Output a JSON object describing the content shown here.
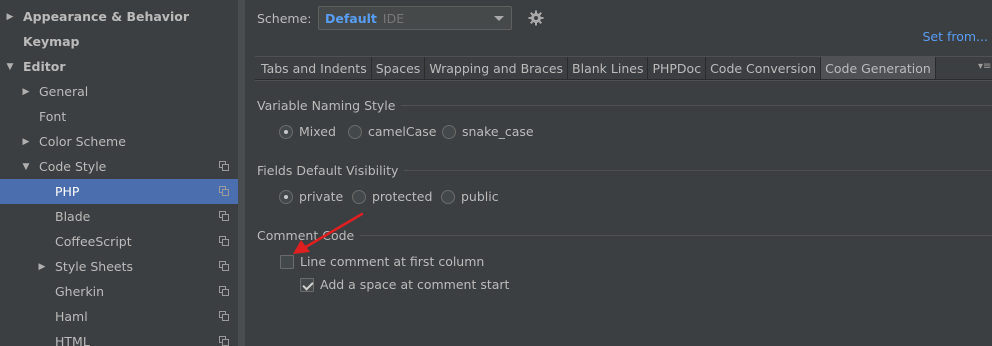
{
  "sidebar": {
    "items": [
      {
        "label": "Appearance & Behavior",
        "expanded": false
      },
      {
        "label": "Keymap"
      },
      {
        "label": "Editor",
        "expanded": true
      },
      {
        "label": "General",
        "expanded": false
      },
      {
        "label": "Font"
      },
      {
        "label": "Color Scheme",
        "expanded": false
      },
      {
        "label": "Code Style",
        "expanded": true
      },
      {
        "label": "PHP",
        "selected": true
      },
      {
        "label": "Blade"
      },
      {
        "label": "CoffeeScript"
      },
      {
        "label": "Style Sheets",
        "expanded": false
      },
      {
        "label": "Gherkin"
      },
      {
        "label": "Haml"
      },
      {
        "label": "HTML"
      }
    ],
    "icons": {
      "collapsed": "▶",
      "expanded": "▼",
      "copy": "copy-icon"
    }
  },
  "header": {
    "scheme_label": "Scheme:",
    "scheme_name": "Default",
    "scheme_type": "IDE",
    "set_from": "Set from..."
  },
  "tabs": [
    {
      "label": "Tabs and Indents"
    },
    {
      "label": "Spaces"
    },
    {
      "label": "Wrapping and Braces"
    },
    {
      "label": "Blank Lines"
    },
    {
      "label": "PHPDoc"
    },
    {
      "label": "Code Conversion"
    },
    {
      "label": "Code Generation",
      "active": true
    }
  ],
  "naming": {
    "title": "Variable Naming Style",
    "options": [
      "Mixed",
      "camelCase",
      "snake_case"
    ],
    "selected": "Mixed"
  },
  "visibility": {
    "title": "Fields Default Visibility",
    "options": [
      "private",
      "protected",
      "public"
    ],
    "selected": "private"
  },
  "comment": {
    "title": "Comment Code",
    "line_comment_first_column": {
      "label": "Line comment at first column",
      "checked": false
    },
    "add_space": {
      "label": "Add a space at comment start",
      "checked": true
    }
  },
  "colors": {
    "background": "#3c3f41",
    "selection": "#4b6eaf",
    "link": "#589df6",
    "annotation_arrow": "#e02020"
  }
}
